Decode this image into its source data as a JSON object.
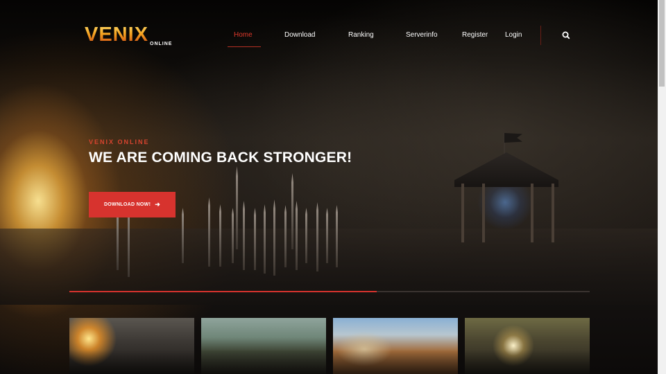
{
  "site": {
    "logo_text": "VENIX",
    "logo_subtext": "ONLINE"
  },
  "nav": {
    "items": [
      {
        "label": "Home",
        "active": true
      },
      {
        "label": "Download",
        "active": false
      },
      {
        "label": "Ranking",
        "active": false
      },
      {
        "label": "Serverinfo",
        "active": false
      },
      {
        "label": "Register",
        "active": false
      },
      {
        "label": "Login",
        "active": false
      }
    ],
    "search_icon": "search-icon"
  },
  "hero": {
    "eyebrow": "VENIX ONLINE",
    "title": "WE ARE COMING BACK STRONGER!",
    "button_label": "DOWNLOAD NOW!",
    "button_icon": "arrow-right-icon"
  },
  "slider": {
    "progress": 0.59
  },
  "thumbnails": [
    {
      "icon": "screenshot-image"
    },
    {
      "icon": "screenshot-image"
    },
    {
      "icon": "screenshot-image"
    },
    {
      "icon": "screenshot-image"
    }
  ],
  "colors": {
    "accent": "#d7332e",
    "nav_active": "#e0392b",
    "text": "#ffffff",
    "background": "#0b0908"
  }
}
